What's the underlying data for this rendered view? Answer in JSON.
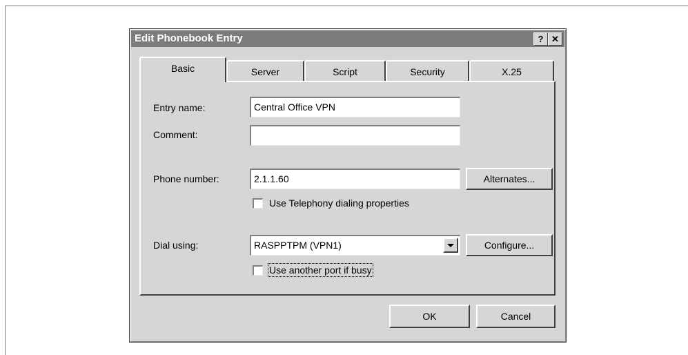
{
  "dialog": {
    "title": "Edit Phonebook Entry",
    "help_label": "?",
    "close_label": "✕"
  },
  "tabs": [
    {
      "label": "Basic",
      "active": true
    },
    {
      "label": "Server"
    },
    {
      "label": "Script"
    },
    {
      "label": "Security"
    },
    {
      "label": "X.25"
    }
  ],
  "form": {
    "entry_name_label": "Entry name:",
    "entry_name_value": "Central Office VPN",
    "comment_label": "Comment:",
    "comment_value": "",
    "phone_number_label": "Phone number:",
    "phone_number_value": "2.1.1.60",
    "alternates_label": "Alternates...",
    "telephony_checkbox_label": "Use Telephony dialing properties",
    "dial_using_label": "Dial using:",
    "dial_using_value": "RASPPTPM (VPN1)",
    "configure_label": "Configure...",
    "another_port_checkbox_label": "Use another port if busy"
  },
  "footer": {
    "ok_label": "OK",
    "cancel_label": "Cancel"
  }
}
